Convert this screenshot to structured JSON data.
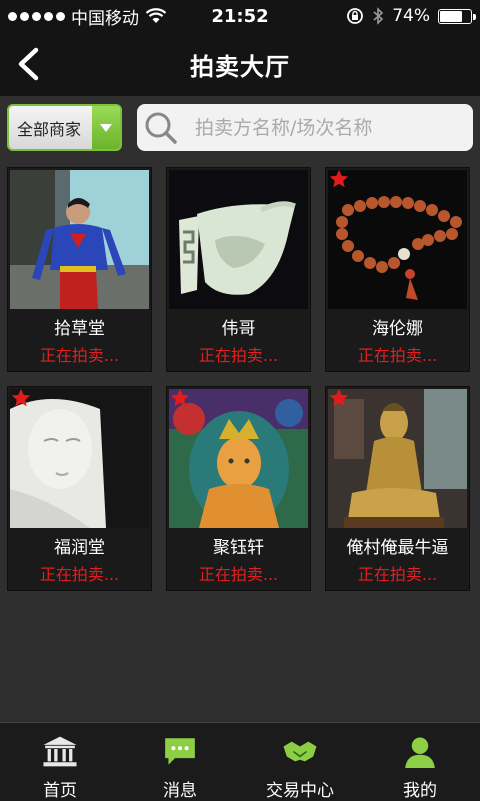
{
  "status_bar": {
    "carrier": "中国移动",
    "time": "21:52",
    "battery": "74%",
    "battery_level": 0.74
  },
  "nav": {
    "title": "拍卖大厅"
  },
  "filter": {
    "merchant_label": "全部商家",
    "search_placeholder": "拍卖方名称/场次名称"
  },
  "auctions": [
    {
      "name": "拾草堂",
      "status": "正在拍卖...",
      "starred": false
    },
    {
      "name": "伟哥",
      "status": "正在拍卖...",
      "starred": false
    },
    {
      "name": "海伦娜",
      "status": "正在拍卖...",
      "starred": true
    },
    {
      "name": "福润堂",
      "status": "正在拍卖...",
      "starred": true
    },
    {
      "name": "聚钰轩",
      "status": "正在拍卖...",
      "starred": true
    },
    {
      "name": "俺村俺最牛逼",
      "status": "正在拍卖...",
      "starred": true
    }
  ],
  "tabs": [
    {
      "label": "首页",
      "icon": "bank-icon"
    },
    {
      "label": "消息",
      "icon": "chat-bubble-icon"
    },
    {
      "label": "交易中心",
      "icon": "handshake-icon"
    },
    {
      "label": "我的",
      "icon": "user-icon"
    }
  ],
  "colors": {
    "accent_green": "#8ccf45",
    "status_red": "#e02020",
    "background": "#2f2f2f",
    "bar": "#141414"
  }
}
